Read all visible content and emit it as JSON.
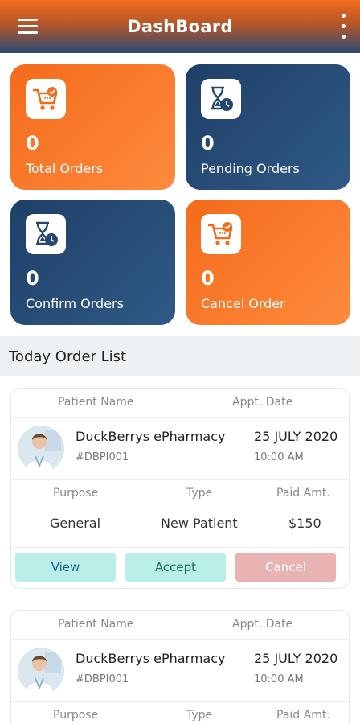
{
  "header": {
    "title": "DashBoard",
    "menu_icon": "hamburger-menu-icon",
    "more_icon": "kebab-icon"
  },
  "tiles": [
    {
      "count": "0",
      "label": "Total Orders",
      "icon": "cart-check-icon",
      "color": "#f46b1c"
    },
    {
      "count": "0",
      "label": "Pending Orders",
      "icon": "hourglass-clock-icon",
      "color": "#24466f"
    },
    {
      "count": "0",
      "label": "Confirm Orders",
      "icon": "hourglass-clock-icon",
      "color": "#24466f"
    },
    {
      "count": "0",
      "label": "Cancel Order",
      "icon": "cart-check-icon",
      "color": "#f46b1c"
    }
  ],
  "section": {
    "title": "Today Order List"
  },
  "orders": [
    {
      "patient_label": "Patient Name",
      "date_label": "Appt. Date",
      "name": "DuckBerrys ePharmacy",
      "id": "#DBPI001",
      "date": "25 JULY 2020",
      "time": "10:00 AM",
      "purpose_label": "Purpose",
      "type_label": "Type",
      "paid_label": "Paid Amt.",
      "purpose": "General",
      "type": "New Patient",
      "paid": "$150",
      "view_label": "View",
      "accept_label": "Accept",
      "cancel_label": "Cancel"
    },
    {
      "patient_label": "Patient Name",
      "date_label": "Appt. Date",
      "name": "DuckBerrys ePharmacy",
      "id": "#DBPI001",
      "date": "25 JULY 2020",
      "time": "10:00 AM",
      "purpose_label": "Purpose",
      "type_label": "Type",
      "paid_label": "Paid Amt."
    }
  ]
}
